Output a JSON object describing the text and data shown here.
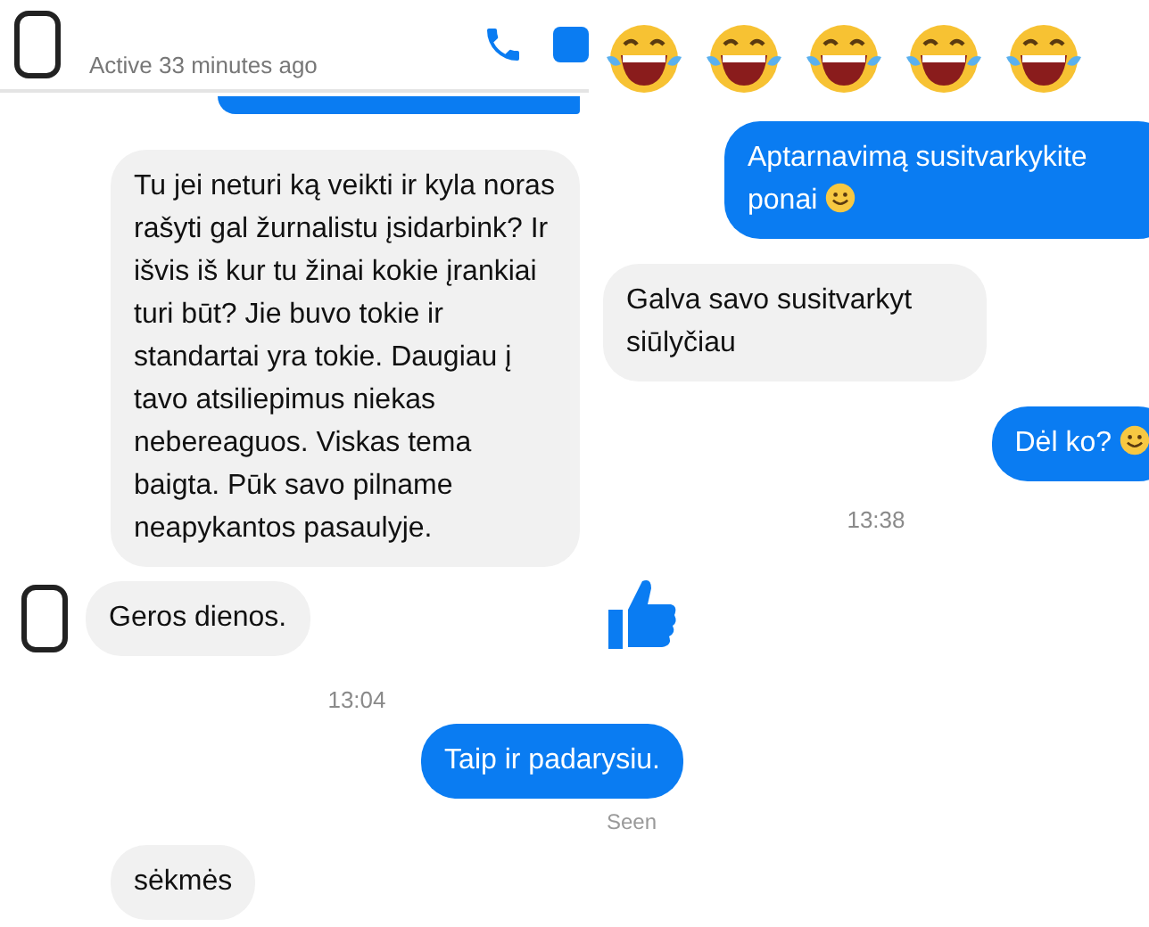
{
  "left_chat": {
    "header": {
      "status": "Active 33 minutes ago"
    },
    "messages": [
      {
        "kind": "sent_cut"
      },
      {
        "kind": "received",
        "text": "Tu jei neturi ką veikti ir kyla noras rašyti gal žurnalistu įsidarbink? Ir išvis iš kur tu žinai kokie įrankiai turi būt? Jie buvo tokie ir standartai yra tokie. Daugiau į tavo atsiliepimus niekas nebereaguos. Viskas tema baigta. Pūk savo pilname neapykantos pasaulyje.",
        "avatar": false,
        "emoji": false
      },
      {
        "kind": "received",
        "text": "Geros dienos.",
        "avatar": true,
        "emoji": false,
        "like": true
      },
      {
        "kind": "time",
        "text": "13:04"
      },
      {
        "kind": "sent",
        "text": "Taip ir padarysiu.",
        "emoji": false
      },
      {
        "kind": "seen",
        "text": "Seen"
      },
      {
        "kind": "received",
        "text": "sėkmės",
        "avatar": false,
        "emoji": false
      }
    ]
  },
  "right_chat": {
    "messages": [
      {
        "kind": "emojis"
      },
      {
        "kind": "sent",
        "text": "Aptarnavimą susitvarkykite ponai",
        "emoji": true
      },
      {
        "kind": "received",
        "text": "Galva savo susitvarkyt siūlyčiau",
        "avatar": false,
        "emoji": false
      },
      {
        "kind": "sent",
        "text": "Dėl ko?",
        "emoji": true
      },
      {
        "kind": "time",
        "text": "13:38"
      }
    ]
  }
}
